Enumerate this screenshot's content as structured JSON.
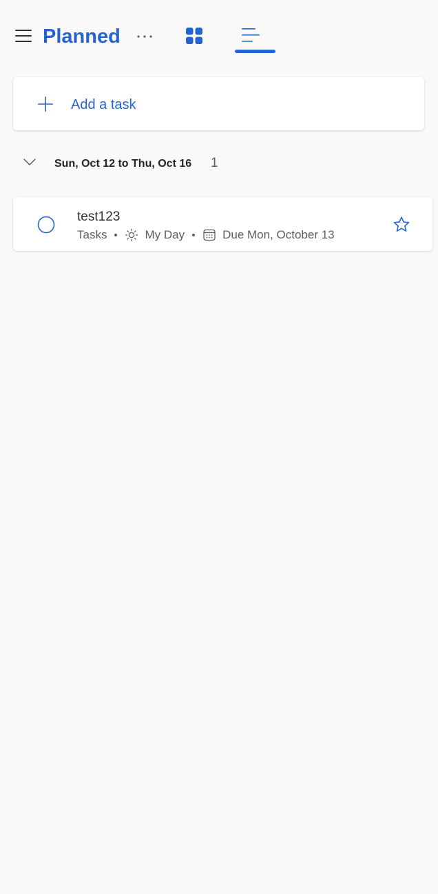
{
  "header": {
    "title": "Planned",
    "more_icon": "more-ellipsis-icon",
    "grid_view_icon": "grid-view-icon",
    "list_view_icon": "list-view-icon",
    "active_view": "list",
    "accent_color": "#2564cf"
  },
  "add_task": {
    "label": "Add a task",
    "icon": "plus-icon"
  },
  "groups": [
    {
      "title": "Sun, Oct 12 to Thu, Oct 16",
      "count": "1",
      "expanded": true,
      "tasks": [
        {
          "title": "test123",
          "list_name": "Tasks",
          "my_day_label": "My Day",
          "due_label": "Due Mon, October 13",
          "completed": false,
          "starred": false
        }
      ]
    }
  ],
  "colors": {
    "background": "#faf9f8",
    "card": "#ffffff",
    "accent": "#2564cf",
    "text_primary": "#323130",
    "text_secondary": "#605e5c"
  }
}
